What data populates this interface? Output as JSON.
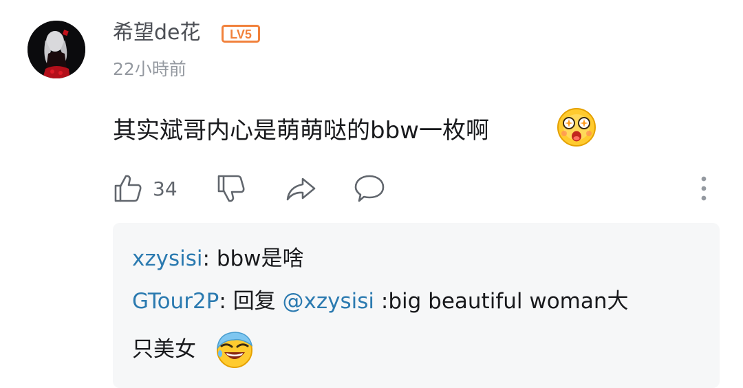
{
  "comment": {
    "username": "希望de花",
    "level_badge": "LV5",
    "timestamp": "22小時前",
    "text": "其实斌哥内心是萌萌哒的bbw一枚啊",
    "emoji": "amazed-face-emoji",
    "like_count": "34"
  },
  "actions": {
    "like_icon": "thumbs-up-icon",
    "dislike_icon": "thumbs-down-icon",
    "share_icon": "share-icon",
    "reply_icon": "comment-bubble-icon",
    "more_icon": "more-vertical-icon"
  },
  "replies": [
    {
      "user": "xzysisi",
      "separator": ": ",
      "text": "bbw是啥"
    },
    {
      "user": "GTour2P",
      "separator": ": ",
      "prefix": "回复 ",
      "mention": "@xzysisi",
      "text": " :big beautiful woman大",
      "text_cont": "只美女",
      "emoji": "laughing-face-emoji"
    }
  ],
  "colors": {
    "username": "#4c4f55",
    "link": "#2b7ab0",
    "badge": "#f1813b",
    "meta": "#9499a0",
    "reply_bg": "#f6f7f8"
  }
}
